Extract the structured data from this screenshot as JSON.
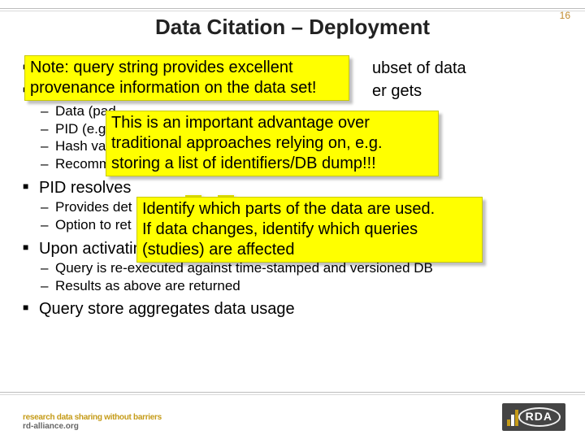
{
  "page_number": "16",
  "title": "Data Citation – Deployment",
  "bullets": {
    "l1a_tail": "ubset of data",
    "l1b_tail": "er gets",
    "l2a_lead": "Data (pad",
    "l2b_lead": "PID (e.g.",
    "l2c_lead": "Hash valu",
    "l2d": "Recommended citation text (e.g. BibTeX)",
    "l1c": "PID resolves",
    "l2e_lead": "Provides det",
    "l2f_lead": "Option to ret",
    "l1d": "Upon activating PID associated with a data citation",
    "l2g": "Query is re-executed against time-stamped and versioned DB",
    "l2h": "Results as above are returned",
    "l1e": "Query store aggregates data usage"
  },
  "note1": {
    "line1": "Note: query string provides excellent",
    "line2": "provenance information on the data set!"
  },
  "note2": {
    "line1": "This is an important advantage over",
    "line2": "traditional approaches relying on, e.g.",
    "line3": "storing a list of identifiers/DB dump!!!"
  },
  "note3": {
    "line1": "Identify which parts of the data are used.",
    "line2": "If data changes, identify which queries",
    "line3": "(studies) are affected"
  },
  "footer": {
    "left1": "research data sharing without barriers",
    "left2": "rd-alliance.org",
    "right": "RDA"
  }
}
